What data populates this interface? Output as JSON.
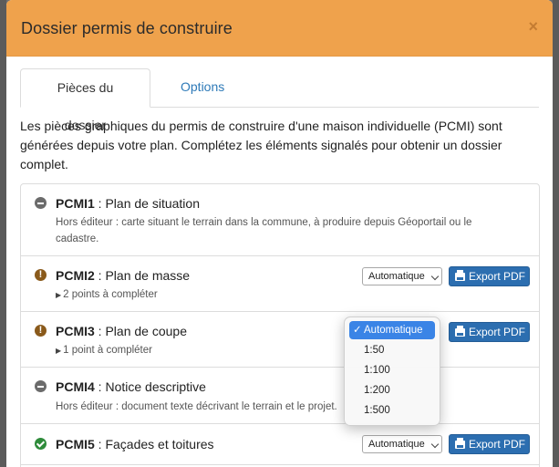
{
  "modal": {
    "title": "Dossier permis de construire",
    "close": "×"
  },
  "tabs": [
    {
      "label": "Pièces du dossier",
      "active": true
    },
    {
      "label": "Options",
      "active": false
    }
  ],
  "intro": "Les pièces graphiques du permis de construire d'une maison individuelle (PCMI) sont générées depuis votre plan. Complétez les éléments signalés pour obtenir un dossier complet.",
  "items": [
    {
      "code": "PCMI1",
      "name": " : Plan de situation",
      "status": "neutral",
      "desc": "Hors éditeur : carte situant le terrain dans la commune, à produire depuis Géoportail ou le cadastre."
    },
    {
      "code": "PCMI2",
      "name": " : Plan de masse",
      "status": "warning",
      "sub": "2 points à compléter",
      "select": "Automatique",
      "export": "Export PDF"
    },
    {
      "code": "PCMI3",
      "name": " : Plan de coupe",
      "status": "warning",
      "sub": "1 point à compléter",
      "export": "Export PDF"
    },
    {
      "code": "PCMI4",
      "name": " : Notice descriptive",
      "status": "neutral",
      "desc": "Hors éditeur : document texte décrivant le terrain et le projet."
    },
    {
      "code": "PCMI5",
      "name": " : Façades et toitures",
      "status": "ok",
      "select": "Automatique",
      "export": "Export PDF"
    }
  ],
  "dropdown": {
    "options": [
      "Automatique",
      "1:50",
      "1:100",
      "1:200",
      "1:500"
    ],
    "selected": "Automatique",
    "check": "✓"
  },
  "colors": {
    "header": "#efa24c",
    "primary_button": "#2c6eb0",
    "link": "#2e7ab8",
    "warning": "#8a5a1b",
    "ok": "#2e8b3a"
  }
}
